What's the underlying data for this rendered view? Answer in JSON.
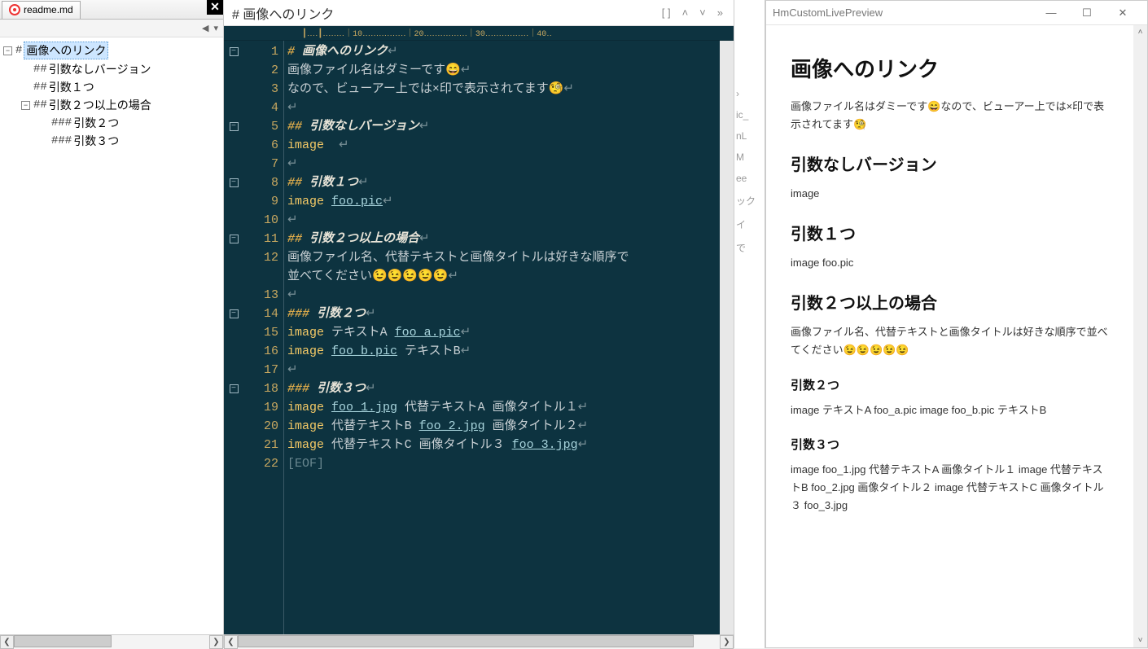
{
  "tab": {
    "filename": "readme.md"
  },
  "outline": {
    "items": [
      {
        "depth": 0,
        "expander": "-",
        "mark": "#",
        "label": "画像へのリンク",
        "selected": true
      },
      {
        "depth": 1,
        "expander": "",
        "mark": "##",
        "label": "引数なしバージョン"
      },
      {
        "depth": 1,
        "expander": "",
        "mark": "##",
        "label": "引数１つ"
      },
      {
        "depth": 1,
        "expander": "-",
        "mark": "##",
        "label": "引数２つ以上の場合"
      },
      {
        "depth": 2,
        "expander": "",
        "mark": "###",
        "label": "引数２つ"
      },
      {
        "depth": 2,
        "expander": "",
        "mark": "###",
        "label": "引数３つ"
      }
    ]
  },
  "editor": {
    "header_title": "#  画像へのリンク",
    "ruler_text": "┃‥‥┃‥‥‥‥｜10‥‥‥‥‥‥‥‥｜20‥‥‥‥‥‥‥‥｜30‥‥‥‥‥‥‥‥｜40‥",
    "lines": [
      {
        "n": 1,
        "fold": "-",
        "segs": [
          {
            "t": "# ",
            "c": "hl-hash"
          },
          {
            "t": "画像へのリンク",
            "c": "hl-head"
          },
          {
            "t": "↵",
            "c": "eol"
          }
        ]
      },
      {
        "n": 2,
        "fold": "",
        "segs": [
          {
            "t": "画像ファイル名はダミーです"
          },
          {
            "t": "😄",
            "c": "emoji"
          },
          {
            "t": "↵",
            "c": "eol"
          }
        ]
      },
      {
        "n": 3,
        "fold": "",
        "segs": [
          {
            "t": "なので、ビューアー上では×印で表示されてます"
          },
          {
            "t": "🧐",
            "c": "emoji"
          },
          {
            "t": "↵",
            "c": "eol"
          }
        ]
      },
      {
        "n": 4,
        "fold": "",
        "segs": [
          {
            "t": "↵",
            "c": "eol"
          }
        ]
      },
      {
        "n": 5,
        "fold": "-",
        "segs": [
          {
            "t": "## ",
            "c": "hl-hash"
          },
          {
            "t": "引数なしバージョン",
            "c": "hl-head"
          },
          {
            "t": "↵",
            "c": "eol"
          }
        ]
      },
      {
        "n": 6,
        "fold": "",
        "segs": [
          {
            "t": "image",
            "c": "hl-kw"
          },
          {
            "t": "  "
          },
          {
            "t": "↵",
            "c": "eol"
          }
        ]
      },
      {
        "n": 7,
        "fold": "",
        "segs": [
          {
            "t": "↵",
            "c": "eol"
          }
        ]
      },
      {
        "n": 8,
        "fold": "-",
        "segs": [
          {
            "t": "## ",
            "c": "hl-hash"
          },
          {
            "t": "引数１つ",
            "c": "hl-head"
          },
          {
            "t": "↵",
            "c": "eol"
          }
        ]
      },
      {
        "n": 9,
        "fold": "",
        "segs": [
          {
            "t": "image",
            "c": "hl-kw"
          },
          {
            "t": " "
          },
          {
            "t": "foo.pic",
            "c": "hl-link"
          },
          {
            "t": "↵",
            "c": "eol"
          }
        ]
      },
      {
        "n": 10,
        "fold": "",
        "segs": [
          {
            "t": "↵",
            "c": "eol"
          }
        ]
      },
      {
        "n": 11,
        "fold": "-",
        "segs": [
          {
            "t": "## ",
            "c": "hl-hash"
          },
          {
            "t": "引数２つ以上の場合",
            "c": "hl-head"
          },
          {
            "t": "↵",
            "c": "eol"
          }
        ]
      },
      {
        "n": 12,
        "fold": "",
        "segs": [
          {
            "t": "画像ファイル名、代替テキストと画像タイトルは好きな順序で"
          }
        ]
      },
      {
        "n": 0,
        "fold": "",
        "segs": [
          {
            "t": "並べてください"
          },
          {
            "t": "😉😉😉😉😉",
            "c": "emoji"
          },
          {
            "t": "↵",
            "c": "eol"
          }
        ],
        "nolabel": true
      },
      {
        "n": 13,
        "fold": "",
        "segs": [
          {
            "t": "↵",
            "c": "eol"
          }
        ]
      },
      {
        "n": 14,
        "fold": "-",
        "segs": [
          {
            "t": "### ",
            "c": "hl-hash"
          },
          {
            "t": "引数２つ",
            "c": "hl-head"
          },
          {
            "t": "↵",
            "c": "eol"
          }
        ]
      },
      {
        "n": 15,
        "fold": "",
        "segs": [
          {
            "t": "image",
            "c": "hl-kw"
          },
          {
            "t": " テキストA "
          },
          {
            "t": "foo_a.pic",
            "c": "hl-link"
          },
          {
            "t": "↵",
            "c": "eol"
          }
        ]
      },
      {
        "n": 16,
        "fold": "",
        "segs": [
          {
            "t": "image",
            "c": "hl-kw"
          },
          {
            "t": " "
          },
          {
            "t": "foo_b.pic",
            "c": "hl-link"
          },
          {
            "t": " テキストB"
          },
          {
            "t": "↵",
            "c": "eol"
          }
        ]
      },
      {
        "n": 17,
        "fold": "",
        "segs": [
          {
            "t": "↵",
            "c": "eol"
          }
        ]
      },
      {
        "n": 18,
        "fold": "-",
        "segs": [
          {
            "t": "### ",
            "c": "hl-hash"
          },
          {
            "t": "引数３つ",
            "c": "hl-head"
          },
          {
            "t": "↵",
            "c": "eol"
          }
        ]
      },
      {
        "n": 19,
        "fold": "",
        "segs": [
          {
            "t": "image",
            "c": "hl-kw"
          },
          {
            "t": " "
          },
          {
            "t": "foo_1.jpg",
            "c": "hl-link"
          },
          {
            "t": " 代替テキストA 画像タイトル１"
          },
          {
            "t": "↵",
            "c": "eol"
          }
        ]
      },
      {
        "n": 20,
        "fold": "",
        "segs": [
          {
            "t": "image",
            "c": "hl-kw"
          },
          {
            "t": " 代替テキストB "
          },
          {
            "t": "foo_2.jpg",
            "c": "hl-link"
          },
          {
            "t": " 画像タイトル２"
          },
          {
            "t": "↵",
            "c": "eol"
          }
        ]
      },
      {
        "n": 21,
        "fold": "",
        "segs": [
          {
            "t": "image",
            "c": "hl-kw"
          },
          {
            "t": " 代替テキストC 画像タイトル３ "
          },
          {
            "t": "foo_3.jpg",
            "c": "hl-link"
          },
          {
            "t": "↵",
            "c": "eol"
          }
        ]
      },
      {
        "n": 22,
        "fold": "",
        "segs": [
          {
            "t": "[EOF]",
            "c": "eof"
          }
        ]
      }
    ]
  },
  "bg_strip": [
    "",
    "›",
    "ic_",
    "nL",
    "M",
    "ee",
    "ック",
    "イ",
    "で"
  ],
  "preview": {
    "window_title": "HmCustomLivePreview",
    "h1": "画像へのリンク",
    "p1": "画像ファイル名はダミーです😄なので、ビューアー上では×印で表示されてます🧐",
    "h2a": "引数なしバージョン",
    "p2a": "image",
    "h2b": "引数１つ",
    "p2b": "image foo.pic",
    "h2c": "引数２つ以上の場合",
    "p2c": "画像ファイル名、代替テキストと画像タイトルは好きな順序で並べてください😉😉😉😉😉",
    "h3a": "引数２つ",
    "p3a": "image テキストA foo_a.pic image foo_b.pic テキストB",
    "h3b": "引数３つ",
    "p3b": "image foo_1.jpg 代替テキストA 画像タイトル１  image 代替テキストB foo_2.jpg 画像タイトル２  image 代替テキストC 画像タイトル３  foo_3.jpg"
  }
}
